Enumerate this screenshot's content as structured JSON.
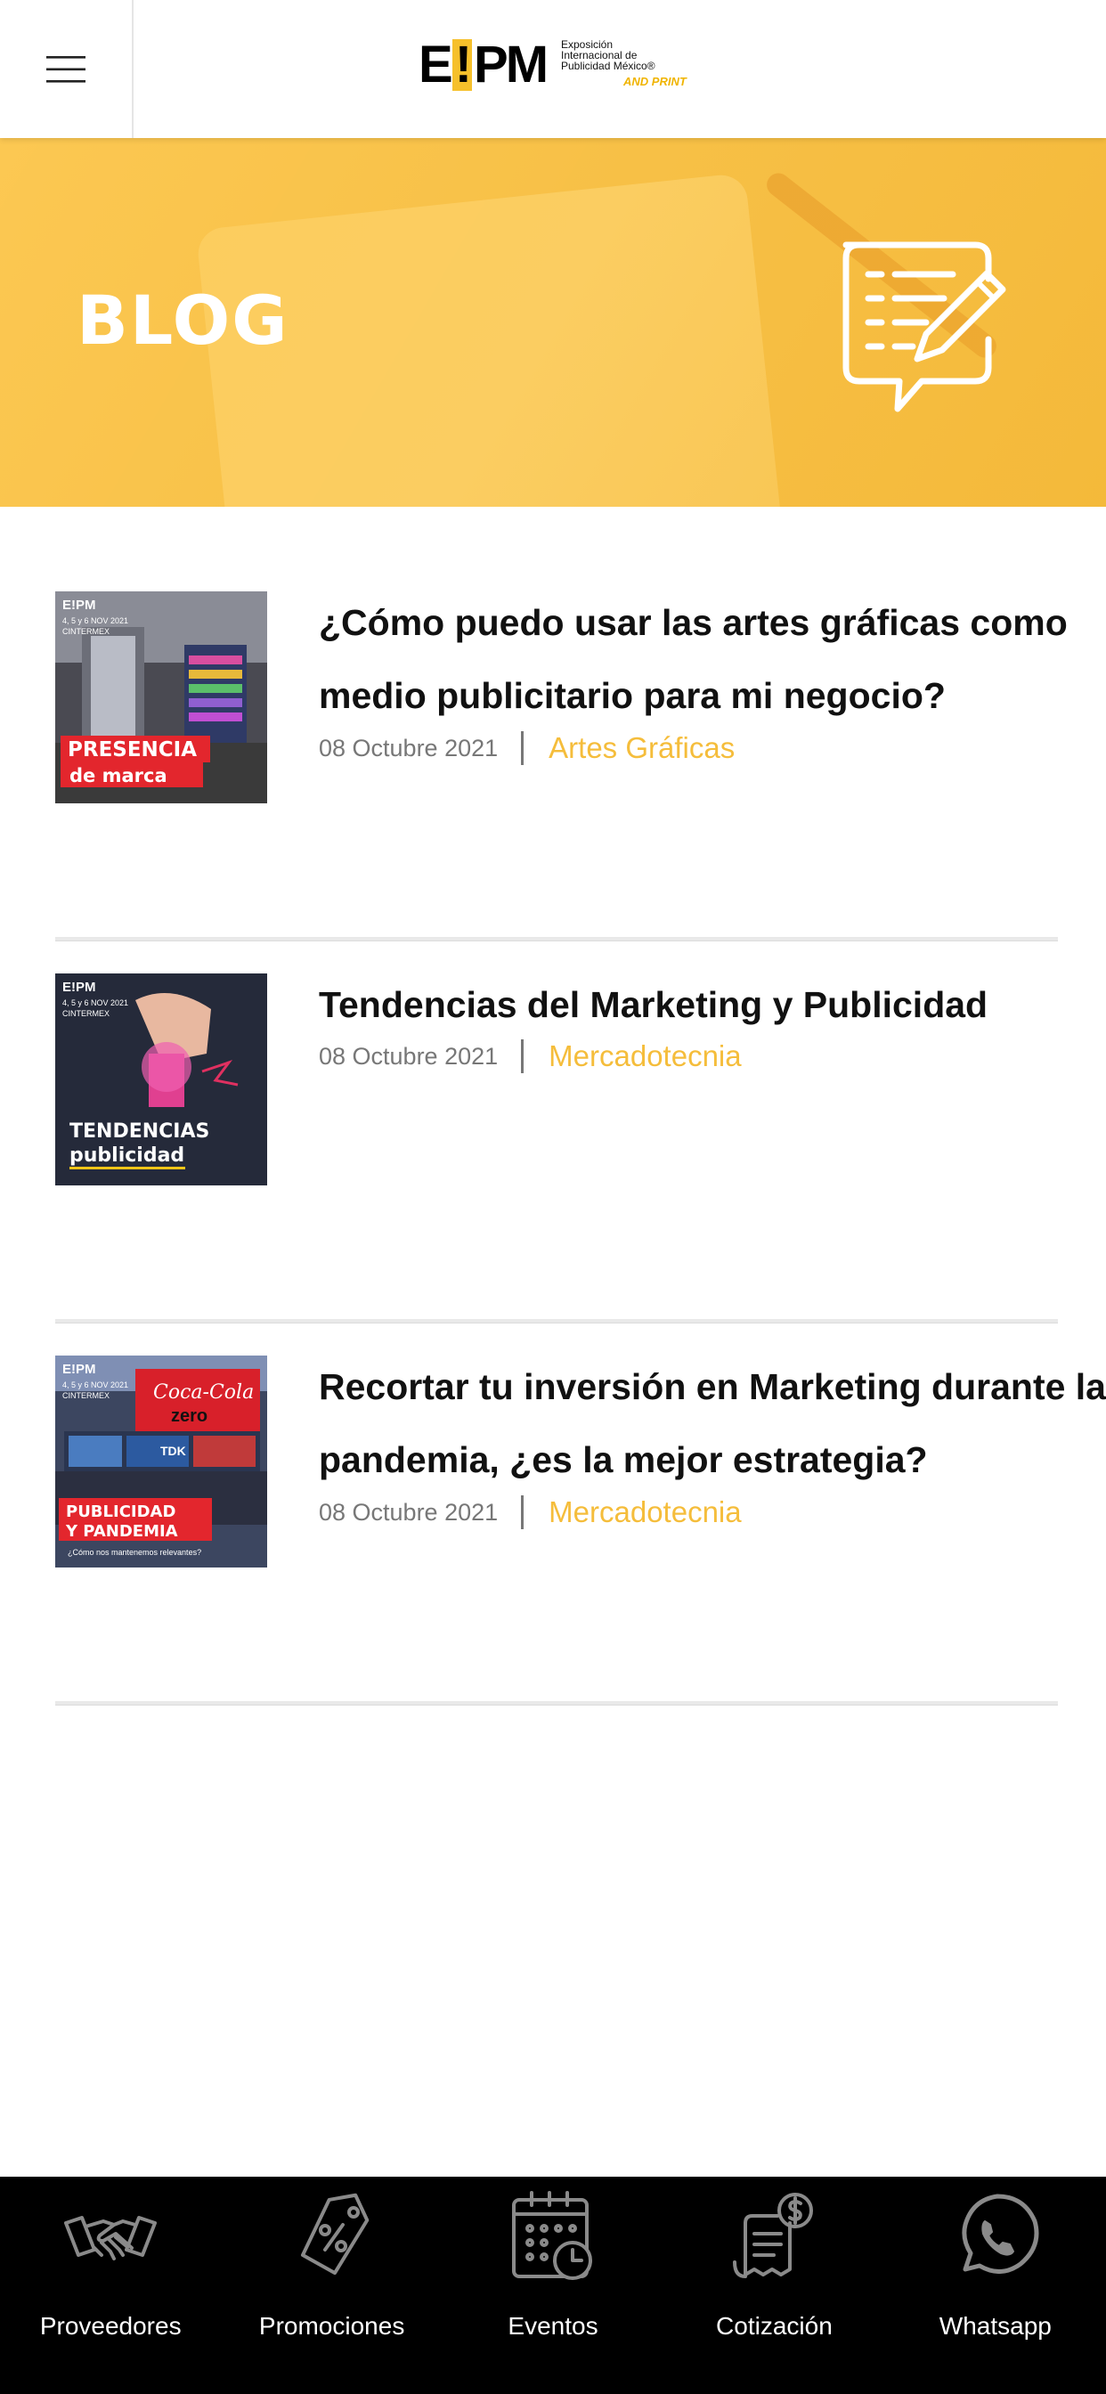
{
  "header": {
    "menu_icon": "hamburger-menu-icon",
    "logo": {
      "main_left": "E",
      "main_bang": "!",
      "main_right": "PM",
      "side_text": "Exposición Internacional de Publicidad México®",
      "tag": "AND PRINT"
    }
  },
  "banner": {
    "title": "BLOG",
    "icon": "blog-note-pencil-icon",
    "color": "#f7c046"
  },
  "posts": [
    {
      "title": "¿Cómo puedo usar las artes gráficas como medio publicitario para mi negocio?",
      "date": "08 Octubre 2021",
      "category": "Artes Gráficas",
      "thumb": {
        "brand": "E!PM",
        "dates": "4, 5 y 6  NOV 2021",
        "venue": "CINTERMEX",
        "caption_1": "PRESENCIA",
        "caption_2": "de marca"
      }
    },
    {
      "title": "Tendencias del Marketing y Publicidad",
      "date": "08 Octubre 2021",
      "category": "Mercadotecnia",
      "thumb": {
        "brand": "E!PM",
        "dates": "4, 5 y 6  NOV 2021",
        "venue": "CINTERMEX",
        "caption_1": "TENDENCIAS",
        "caption_2": "publicidad"
      }
    },
    {
      "title": "Recortar tu inversión en Marketing durante la pandemia, ¿es la mejor estrategia?",
      "date": "08 Octubre 2021",
      "category": "Mercadotecnia",
      "thumb": {
        "brand": "E!PM",
        "dates": "4, 5 y 6  NOV 2021",
        "venue": "CINTERMEX",
        "caption_1": "PUBLICIDAD",
        "caption_2": "Y PANDEMIA",
        "caption_3": "¿Cómo nos mantenemos relevantes?",
        "sign_1": "Coca-Cola",
        "sign_2": "zero",
        "sign_3": "TDK"
      }
    }
  ],
  "bottom_nav": [
    {
      "label": "Proveedores",
      "icon": "handshake-icon"
    },
    {
      "label": "Promociones",
      "icon": "discount-tag-icon"
    },
    {
      "label": "Eventos",
      "icon": "calendar-clock-icon"
    },
    {
      "label": "Cotización",
      "icon": "invoice-dollar-icon"
    },
    {
      "label": "Whatsapp",
      "icon": "whatsapp-icon"
    }
  ],
  "colors": {
    "accent": "#f5bd3b",
    "nav_background": "#000000",
    "title_text": "#111111",
    "meta_text": "#777777"
  }
}
